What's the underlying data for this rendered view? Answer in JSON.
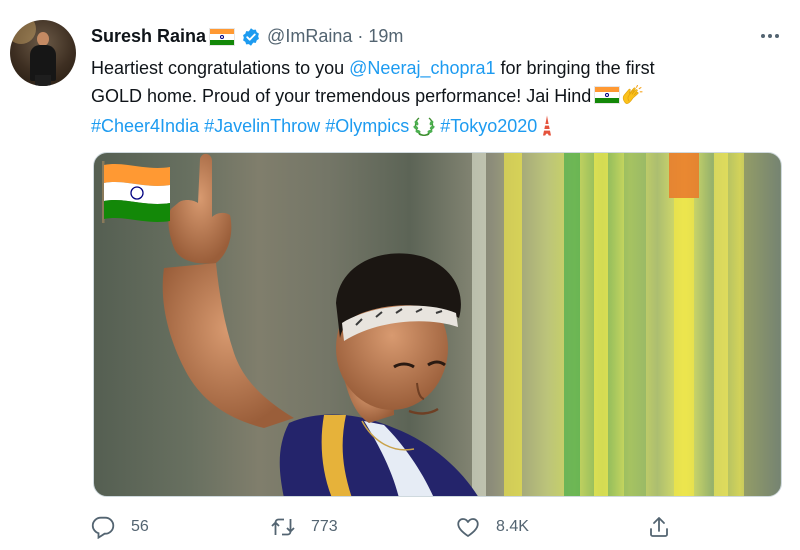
{
  "tweet": {
    "author_name": "Suresh Raina",
    "handle": "@ImRaina",
    "separator": "·",
    "time": "19m",
    "text_line1_prefix": "Heartiest congratulations to you ",
    "mention": "@Neeraj_chopra1",
    "text_line1_suffix": " for bringing the first",
    "text_line2": "GOLD home. Proud of your tremendous performance! Jai Hind",
    "hashtags": [
      "#Cheer4India",
      "#JavelinThrow",
      "#Olympics",
      "#Tokyo2020"
    ],
    "emojis": [
      "india-flag",
      "clapping-hands",
      "laurel-wreath",
      "tokyo-tower"
    ]
  },
  "metrics": {
    "replies": "56",
    "retweets": "773",
    "likes": "8.4K"
  },
  "colors": {
    "accent": "#1d9bf0",
    "text": "#0f1419",
    "muted": "#536471",
    "border": "#cfd9de"
  },
  "icons": [
    "verified-badge-icon",
    "more-icon",
    "reply-icon",
    "retweet-icon",
    "like-icon",
    "share-icon"
  ]
}
